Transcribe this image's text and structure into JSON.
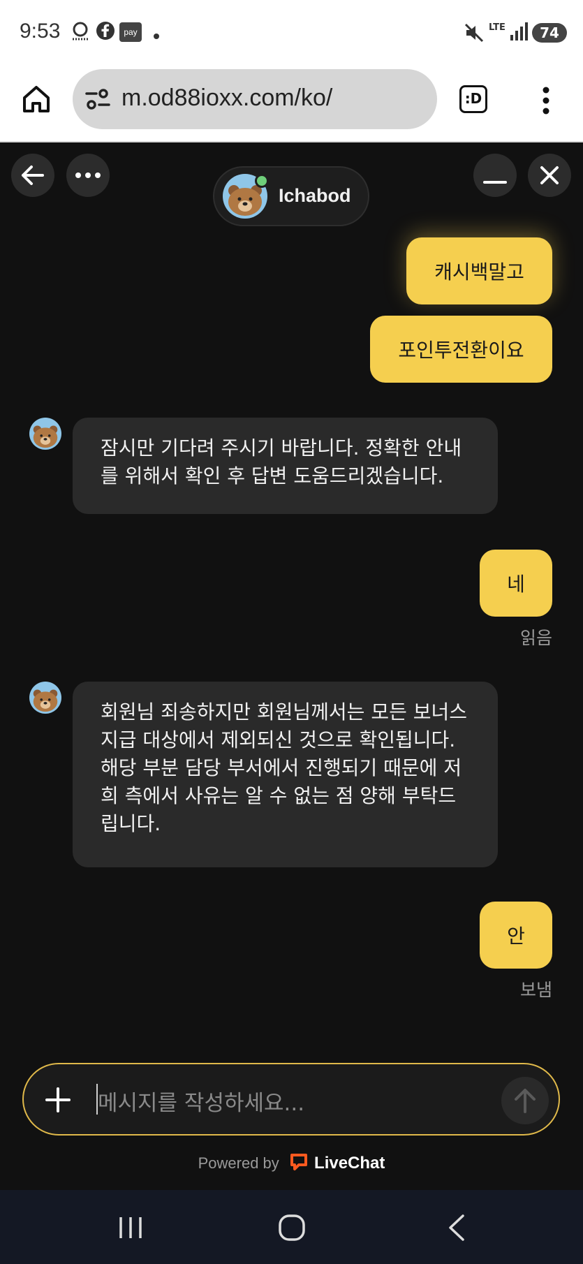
{
  "status_bar": {
    "time": "9:53",
    "icons": [
      "assistant-icon",
      "facebook-icon",
      "pay-icon",
      "dot-icon",
      "mute-icon",
      "lte-icon",
      "signal-icon",
      "battery-icon"
    ],
    "pay_label": "pay",
    "lte_label": "LTE",
    "battery": "74"
  },
  "browser": {
    "url": "m.od88ioxx.com/ko/",
    "tab_label": ":D"
  },
  "chat": {
    "agent_name": "Ichabod",
    "agent_status_color": "#6fcf7a",
    "messages": [
      {
        "from": "user",
        "text": "캐시백말고"
      },
      {
        "from": "user",
        "text": "포인투전환이요"
      },
      {
        "from": "agent",
        "text": "잠시만 기다려 주시기 바랍니다. 정확한 안내를 위해서 확인 후 답변 도움드리겠습니다."
      },
      {
        "from": "user",
        "text": "네",
        "status": "읽음"
      },
      {
        "from": "agent",
        "text": "회원님 죄송하지만 회원님께서는 모든 보너스 지급 대상에서 제외되신 것으로 확인됩니다. 해당 부분 담당 부서에서 진행되기 때문에 저희 측에서 사유는 알 수 없는 점 양해 부탁드립니다."
      },
      {
        "from": "user",
        "text": "안",
        "status": "보냄"
      }
    ],
    "composer": {
      "placeholder": "메시지를 작성하세요..."
    },
    "powered_by": "Powered by",
    "brand": "LiveChat"
  },
  "colors": {
    "user_bubble": "#f5cf4f",
    "agent_bubble": "#2a2a2a",
    "background": "#111111",
    "brand_accent": "#ff5a1f"
  }
}
